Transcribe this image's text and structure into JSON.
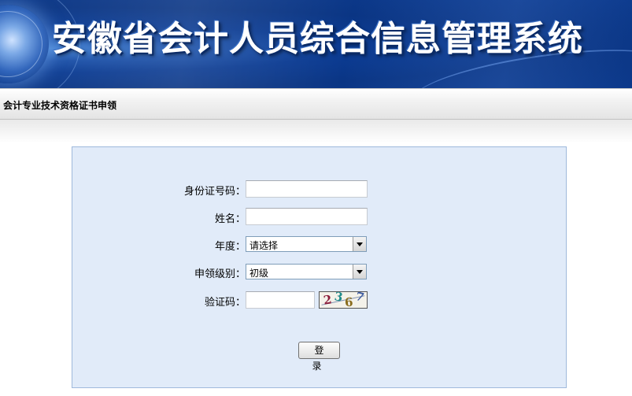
{
  "banner": {
    "title": "安徽省会计人员综合信息管理系统"
  },
  "breadcrumb": "会计专业技术资格证书申领",
  "form": {
    "id_label": "身份证号码：",
    "id_value": "",
    "name_label": "姓名：",
    "name_value": "",
    "year_label": "年度：",
    "year_selected": "请选择",
    "level_label": "申领级别：",
    "level_selected": "初级",
    "captcha_label": "验证码：",
    "captcha_value": "",
    "captcha_chars": [
      "2",
      "3",
      "6",
      "7"
    ],
    "submit_label": "登 录"
  }
}
